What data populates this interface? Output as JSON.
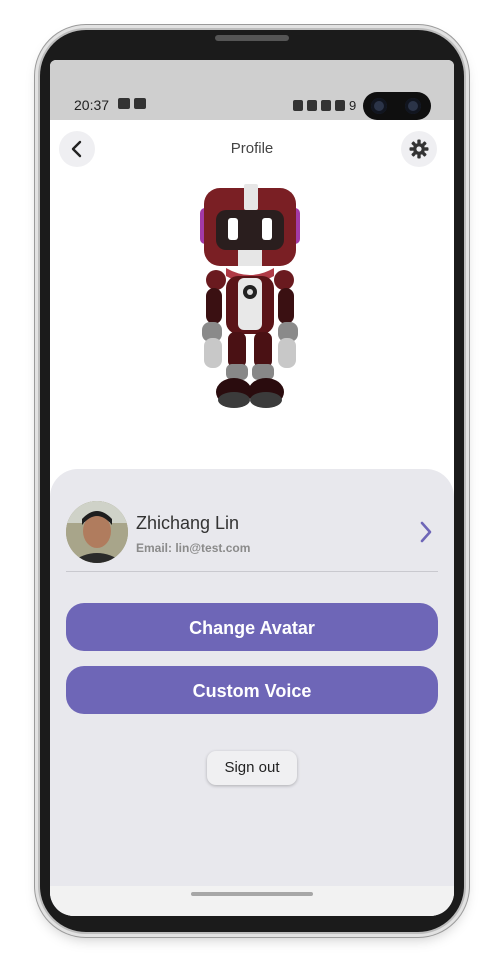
{
  "status_bar": {
    "time": "20:37",
    "battery_text": "9",
    "icons": [
      "gallery-icon",
      "teams-icon",
      "alarm-icon",
      "mute-icon",
      "4g-icon",
      "signal-icon"
    ]
  },
  "header": {
    "title": "Profile",
    "back_icon": "chevron-left-icon",
    "settings_icon": "gear-icon"
  },
  "avatar": {
    "description_icon": "robot-avatar"
  },
  "user": {
    "name": "Zhichang Lin",
    "email": "Email: lin@test.com"
  },
  "actions": {
    "change_avatar": "Change Avatar",
    "custom_voice": "Custom Voice",
    "sign_out": "Sign out"
  },
  "colors": {
    "accent": "#6e66b7",
    "card_bg": "#e8e8ed",
    "robot_primary": "#7a1f24",
    "robot_visor": "#2a1e1e"
  }
}
